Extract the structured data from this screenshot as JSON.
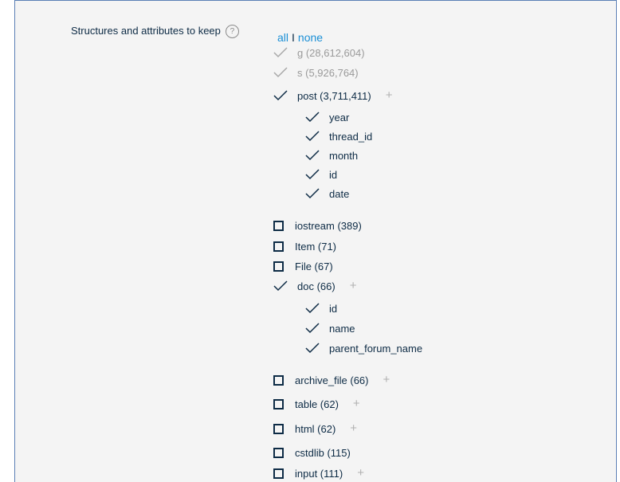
{
  "label": "Structures and attributes to keep",
  "help_glyph": "?",
  "links": {
    "all": "all",
    "separator": "I",
    "none": "none"
  },
  "items": [
    {
      "text": "g (28,612,604)",
      "state": "check",
      "dim": true,
      "plus": false
    },
    {
      "text": "s (5,926,764)",
      "state": "check",
      "dim": true,
      "plus": false
    },
    {
      "text": "post (3,711,411)",
      "state": "check",
      "dim": false,
      "plus": true,
      "attrs": [
        "year",
        "thread_id",
        "month",
        "id",
        "date"
      ]
    },
    {
      "text": "iostream (389)",
      "state": "box",
      "plus": false
    },
    {
      "text": "Item (71)",
      "state": "box",
      "plus": false
    },
    {
      "text": "File (67)",
      "state": "box",
      "plus": false
    },
    {
      "text": "doc (66)",
      "state": "check",
      "dim": false,
      "plus": true,
      "attrs": [
        "id",
        "name",
        "parent_forum_name"
      ]
    },
    {
      "text": "archive_file (66)",
      "state": "box",
      "plus": true
    },
    {
      "text": "table (62)",
      "state": "box",
      "plus": true
    },
    {
      "text": "html (62)",
      "state": "box",
      "plus": true
    },
    {
      "text": "cstdlib (115)",
      "state": "box",
      "plus": false
    },
    {
      "text": "input (111)",
      "state": "box",
      "plus": true
    }
  ],
  "plus_glyph": "+"
}
